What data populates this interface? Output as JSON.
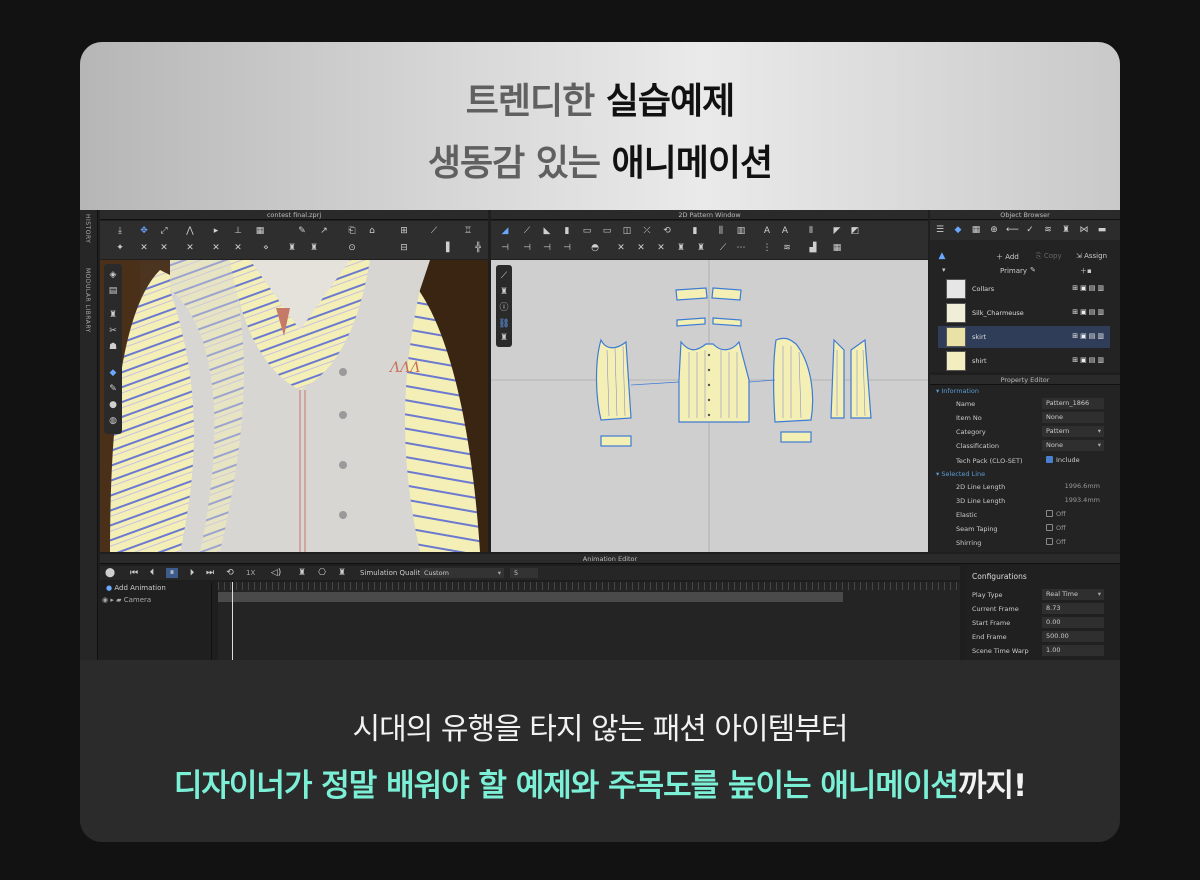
{
  "hero": {
    "line1_muted": "트렌디한 ",
    "line1_strong": "실습예제",
    "line2_muted": "생동감 있는 ",
    "line2_strong": "애니메이션"
  },
  "app": {
    "side_tabs": [
      "HISTORY",
      "MODULAR LIBRARY"
    ],
    "viewport3d_title": "contest final.zprj",
    "pattern_window_title": "2D Pattern Window",
    "object_browser": {
      "title": "Object Browser",
      "add_label": "Add",
      "copy_label": "Copy",
      "assign_label": "Assign",
      "group_label": "Primary",
      "items": [
        {
          "name": "Collars",
          "color": "#e6e6e6",
          "selected": false
        },
        {
          "name": "Silk_Charmeuse",
          "color": "#f1eed8",
          "selected": false
        },
        {
          "name": "skirt",
          "color": "#e9e1a6",
          "selected": true
        },
        {
          "name": "shirt",
          "color": "#f3eec0",
          "selected": false
        }
      ]
    },
    "property_editor": {
      "title": "Property Editor",
      "section_info": "Information",
      "section_line": "Selected Line",
      "name_label": "Name",
      "name_value": "Pattern_1866",
      "itemno_label": "Item No",
      "itemno_value": "None",
      "category_label": "Category",
      "category_value": "Pattern",
      "classification_label": "Classification",
      "classification_value": "None",
      "techpack_label": "Tech Pack (CLO-SET)",
      "techpack_value": "Include",
      "len2d_label": "2D Line Length",
      "len2d_value": "1996.6mm",
      "len3d_label": "3D Line Length",
      "len3d_value": "1993.4mm",
      "elastic_label": "Elastic",
      "elastic_value": "Off",
      "taping_label": "Seam Taping",
      "taping_value": "Off",
      "shirring_label": "Shirring",
      "shirring_value": "Off"
    },
    "animation_editor": {
      "title": "Animation Editor",
      "speed": "1X",
      "quality_label": "Simulation Quality",
      "quality_value": "Custom",
      "quality_steps": "5",
      "add_animation": "Add Animation",
      "camera": "Camera",
      "config_title": "Configurations",
      "play_type_label": "Play Type",
      "play_type_value": "Real Time",
      "current_frame_label": "Current Frame",
      "current_frame_value": "8.73",
      "start_frame_label": "Start Frame",
      "start_frame_value": "0.00",
      "end_frame_label": "End Frame",
      "end_frame_value": "500.00",
      "time_warp_label": "Scene Time Warp",
      "time_warp_value": "1.00"
    },
    "colors": {
      "accent": "#5b9bd5",
      "selected_row": "#2f3d59",
      "pattern_fill": "#f4efb5",
      "pattern_outline": "#3d7bd6"
    }
  },
  "caption": {
    "line1": "시대의 유행을 타지 않는 패션 아이템부터",
    "line2_highlight": "디자이너가 정말 배워야 할 예제와 주목도를 높이는 애니메이션",
    "line2_tail": "까지!"
  }
}
